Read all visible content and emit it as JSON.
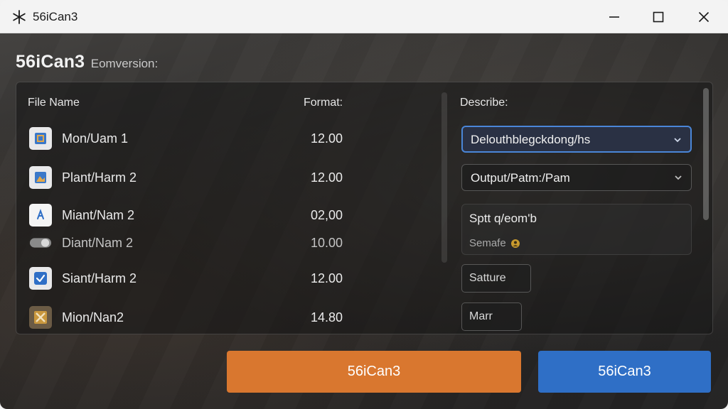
{
  "window": {
    "title": "56iCan3",
    "app_icon": "asterisk-icon",
    "controls": {
      "minimize": "minimize-icon",
      "maximize": "maximize-icon",
      "close": "close-icon"
    }
  },
  "header": {
    "title": "56iCan3",
    "subtitle": "Eomversion:"
  },
  "table": {
    "columns": {
      "file_name": "File Name",
      "format": "Format:",
      "describe": "Describe:"
    },
    "rows": [
      {
        "name": "Mon/Uam 1",
        "value": "12.00",
        "icon": "image-file-icon"
      },
      {
        "name": "Plant/Harm 2",
        "value": "12.00",
        "icon": "image-file-icon"
      },
      {
        "name": "Miant/Nam 2",
        "value": "02,00",
        "icon": "document-file-icon"
      },
      {
        "name": "Diant/Nam 2",
        "value": "10.00",
        "icon": "toggle-icon"
      },
      {
        "name": "Siant/Harm 2",
        "value": "12.00",
        "icon": "checkbox-icon"
      },
      {
        "name": "Mion/Nan2",
        "value": "14.80",
        "icon": "archive-file-icon"
      }
    ]
  },
  "describe": {
    "select1": {
      "value": "Delouthblegckdong/hs",
      "icon": "chevron-down-icon"
    },
    "select2": {
      "value": "Output/Patm:/Pam",
      "icon": "chevron-down-icon"
    },
    "textbox": {
      "value": "Sptt q/eom'b",
      "sub_label": "Semafe",
      "sub_icon": "user-badge-icon"
    },
    "field1": "Satture",
    "field2": "Marr"
  },
  "buttons": {
    "primary": "56iCan3",
    "secondary": "56iCan3"
  },
  "colors": {
    "accent_blue": "#2f6fc6",
    "accent_orange": "#d9772f",
    "focus_border": "#4a86d8"
  }
}
